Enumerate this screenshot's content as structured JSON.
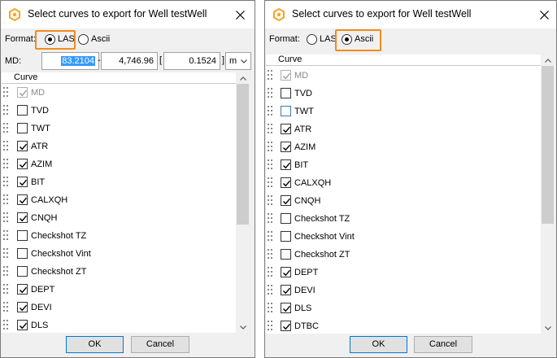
{
  "left": {
    "title": "Select curves to export for Well testWell",
    "format_label": "Format:",
    "format_options": [
      "LAS",
      "Ascii"
    ],
    "selected_format": "LAS",
    "md_label": "MD:",
    "md_from": "83.2104",
    "md_sep": "-",
    "md_to": "4,746.96",
    "md_step_open": "[",
    "md_step": "0.1524",
    "md_step_close": "]",
    "md_unit": "m",
    "column_header": "Curve",
    "curves": [
      {
        "name": "MD",
        "checked": true,
        "disabled": true
      },
      {
        "name": "TVD",
        "checked": false
      },
      {
        "name": "TWT",
        "checked": false
      },
      {
        "name": "ATR",
        "checked": true
      },
      {
        "name": "AZIM",
        "checked": true
      },
      {
        "name": "BIT",
        "checked": true
      },
      {
        "name": "CALXQH",
        "checked": true
      },
      {
        "name": "CNQH",
        "checked": true
      },
      {
        "name": "Checkshot TZ",
        "checked": false
      },
      {
        "name": "Checkshot Vint",
        "checked": false
      },
      {
        "name": "Checkshot ZT",
        "checked": false
      },
      {
        "name": "DEPT",
        "checked": true
      },
      {
        "name": "DEVI",
        "checked": true
      },
      {
        "name": "DLS",
        "checked": true
      }
    ],
    "ok_label": "OK",
    "cancel_label": "Cancel"
  },
  "right": {
    "title": "Select curves to export for Well testWell",
    "format_label": "Format:",
    "format_options": [
      "LAS",
      "Ascii"
    ],
    "selected_format": "Ascii",
    "column_header": "Curve",
    "curves": [
      {
        "name": "MD",
        "checked": true,
        "disabled": true
      },
      {
        "name": "TVD",
        "checked": false
      },
      {
        "name": "TWT",
        "checked": false,
        "focused": true
      },
      {
        "name": "ATR",
        "checked": true
      },
      {
        "name": "AZIM",
        "checked": true
      },
      {
        "name": "BIT",
        "checked": true
      },
      {
        "name": "CALXQH",
        "checked": true
      },
      {
        "name": "CNQH",
        "checked": true
      },
      {
        "name": "Checkshot TZ",
        "checked": false
      },
      {
        "name": "Checkshot Vint",
        "checked": false
      },
      {
        "name": "Checkshot ZT",
        "checked": false
      },
      {
        "name": "DEPT",
        "checked": true
      },
      {
        "name": "DEVI",
        "checked": true
      },
      {
        "name": "DLS",
        "checked": true
      },
      {
        "name": "DTBC",
        "checked": true
      }
    ],
    "ok_label": "OK",
    "cancel_label": "Cancel"
  },
  "colors": {
    "highlight": "#f08c1c",
    "app_icon": "#f5a623",
    "selection": "#3399ff",
    "default_button_border": "#0078d7"
  },
  "icons": {
    "app": "hexagon-app-icon",
    "close": "close-icon",
    "grip": "drag-handle-icon",
    "unit_dropdown": "chevron-down-icon",
    "scroll_up": "scroll-up-arrow-icon",
    "scroll_down": "scroll-down-arrow-icon"
  }
}
